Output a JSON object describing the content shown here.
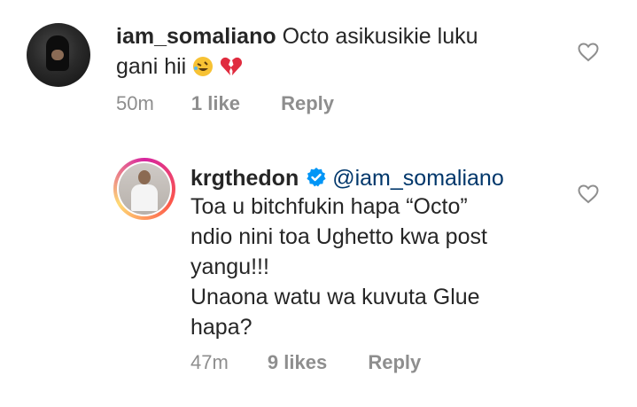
{
  "comments": [
    {
      "username": "iam_somaliano",
      "text_line1": "Octo asikusikie luku",
      "text_line2": "gani hii",
      "emojis": [
        "rolling-on-floor-laughing",
        "broken-heart"
      ],
      "time": "50m",
      "likes": "1 like",
      "reply_label": "Reply"
    },
    {
      "username": "krgthedon",
      "verified": true,
      "mention": "@iam_somaliano",
      "lines": [
        "Toa u bitchfukin hapa “Octo”",
        "ndio nini toa Ughetto kwa post",
        "yangu!!!",
        "Unaona watu wa kuvuta Glue",
        "hapa?"
      ],
      "time": "47m",
      "likes": "9 likes",
      "reply_label": "Reply"
    }
  ],
  "colors": {
    "text": "#262626",
    "meta": "#8e8e8e",
    "mention": "#00376b",
    "verified": "#0095f6"
  }
}
